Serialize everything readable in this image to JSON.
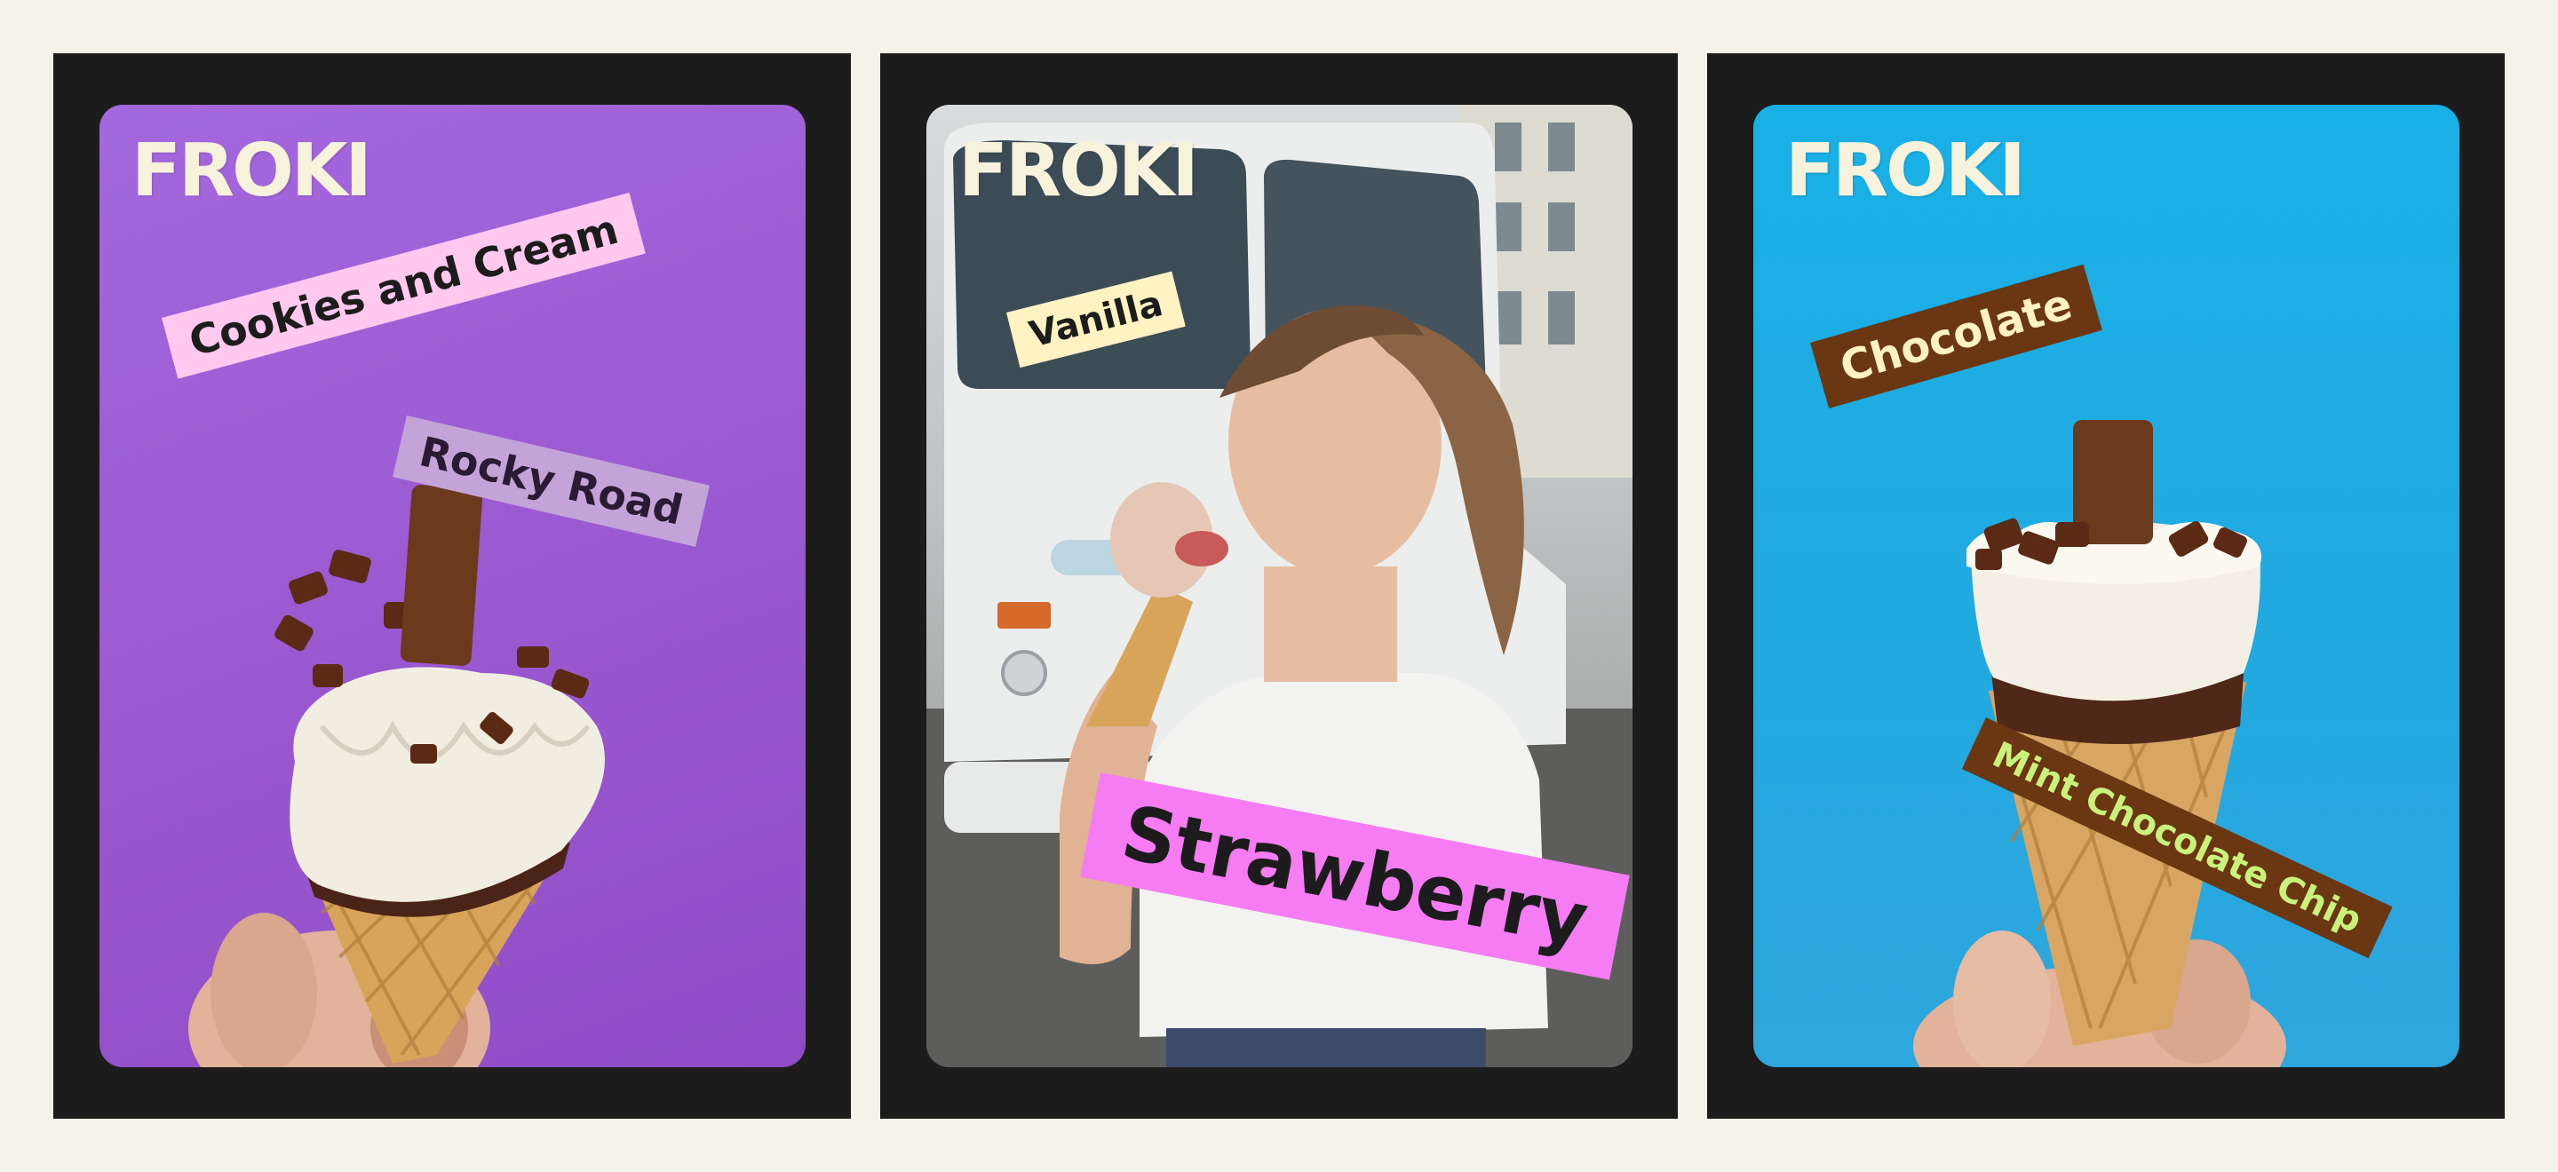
{
  "brand": "FROKI",
  "cards": [
    {
      "flavors": [
        "Cookies and Cream",
        "Rocky Road"
      ]
    },
    {
      "flavors": [
        "Vanilla",
        "Strawberry"
      ]
    },
    {
      "flavors": [
        "Chocolate",
        "Mint Chocolate Chip"
      ]
    }
  ],
  "colors": {
    "page_bg": "#f5f3e9",
    "panel_bg": "#1c1c1c",
    "card1_bg": "#9a58d0",
    "card2_bg": "#c8cbcc",
    "card3_bg": "#22a9e0",
    "brand_text": "#f7f2dc",
    "pink_label": "#ffc8ef",
    "lilac_label": "#c4a4d8",
    "cream_label": "#fff2c2",
    "magenta_label": "#f57cf3",
    "brown_label": "#6a3712",
    "lime_text": "#c9f27c"
  }
}
